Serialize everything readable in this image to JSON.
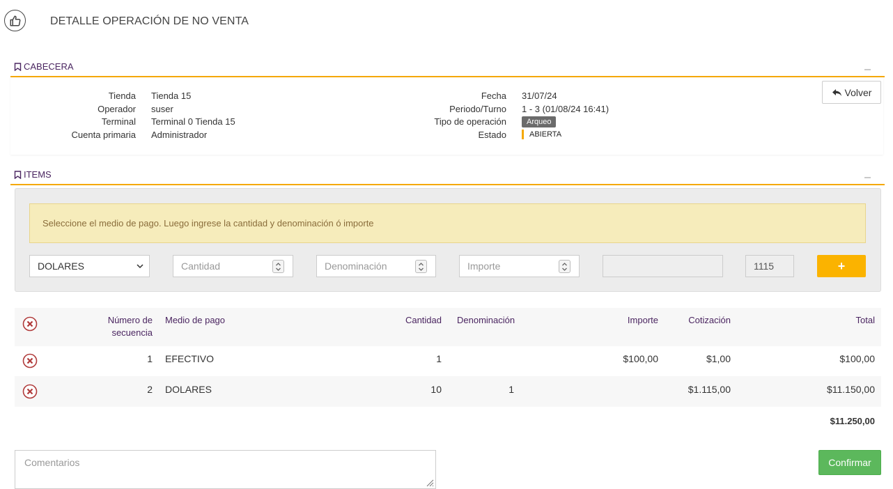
{
  "header": {
    "title": "DETALLE OPERACIÓN DE NO VENTA",
    "icon": "thumbs-up-icon"
  },
  "cabecera": {
    "title": "CABECERA",
    "left": [
      {
        "label": "Tienda",
        "value": "Tienda 15"
      },
      {
        "label": "Operador",
        "value": "suser"
      },
      {
        "label": "Terminal",
        "value": "Terminal 0 Tienda 15"
      },
      {
        "label": "Cuenta primaria",
        "value": "Administrador"
      }
    ],
    "right": {
      "fecha_label": "Fecha",
      "fecha": "31/07/24",
      "periodo_label": "Periodo/Turno",
      "periodo": "1 - 3 (01/08/24 16:41)",
      "tipo_label": "Tipo de operación",
      "tipo": "Arqueo",
      "estado_label": "Estado",
      "estado": "ABIERTA"
    },
    "volver_label": "Volver"
  },
  "items": {
    "title": "ITEMS",
    "alert": "Seleccione el medio de pago. Luego ingrese la cantidad y denominación ó importe",
    "form": {
      "medio_pago_selected": "DOLARES",
      "cantidad_placeholder": "Cantidad",
      "denominacion_placeholder": "Denominación",
      "importe_placeholder": "Importe",
      "disabled_value": "",
      "cotizacion_value": "1115",
      "add_label": "+"
    },
    "table": {
      "headers": {
        "secuencia_1": "Número de",
        "secuencia_2": "secuencia",
        "medio": "Medio de pago",
        "cantidad": "Cantidad",
        "denominacion": "Denominación",
        "importe": "Importe",
        "cotizacion": "Cotización",
        "total": "Total"
      },
      "rows": [
        {
          "seq": "1",
          "medio": "EFECTIVO",
          "cantidad": "1",
          "denominacion": "",
          "importe": "$100,00",
          "cotizacion": "$1,00",
          "total": "$100,00"
        },
        {
          "seq": "2",
          "medio": "DOLARES",
          "cantidad": "10",
          "denominacion": "1",
          "importe": "",
          "cotizacion": "$1.115,00",
          "total": "$11.150,00"
        }
      ],
      "grand_total": "$11.250,00"
    }
  },
  "footer": {
    "comments_placeholder": "Comentarios",
    "confirm_label": "Confirmar"
  },
  "colors": {
    "accent": "#f5a800",
    "heading": "#4a2560",
    "confirm": "#5cb85c",
    "delete": "#b03a3a"
  }
}
